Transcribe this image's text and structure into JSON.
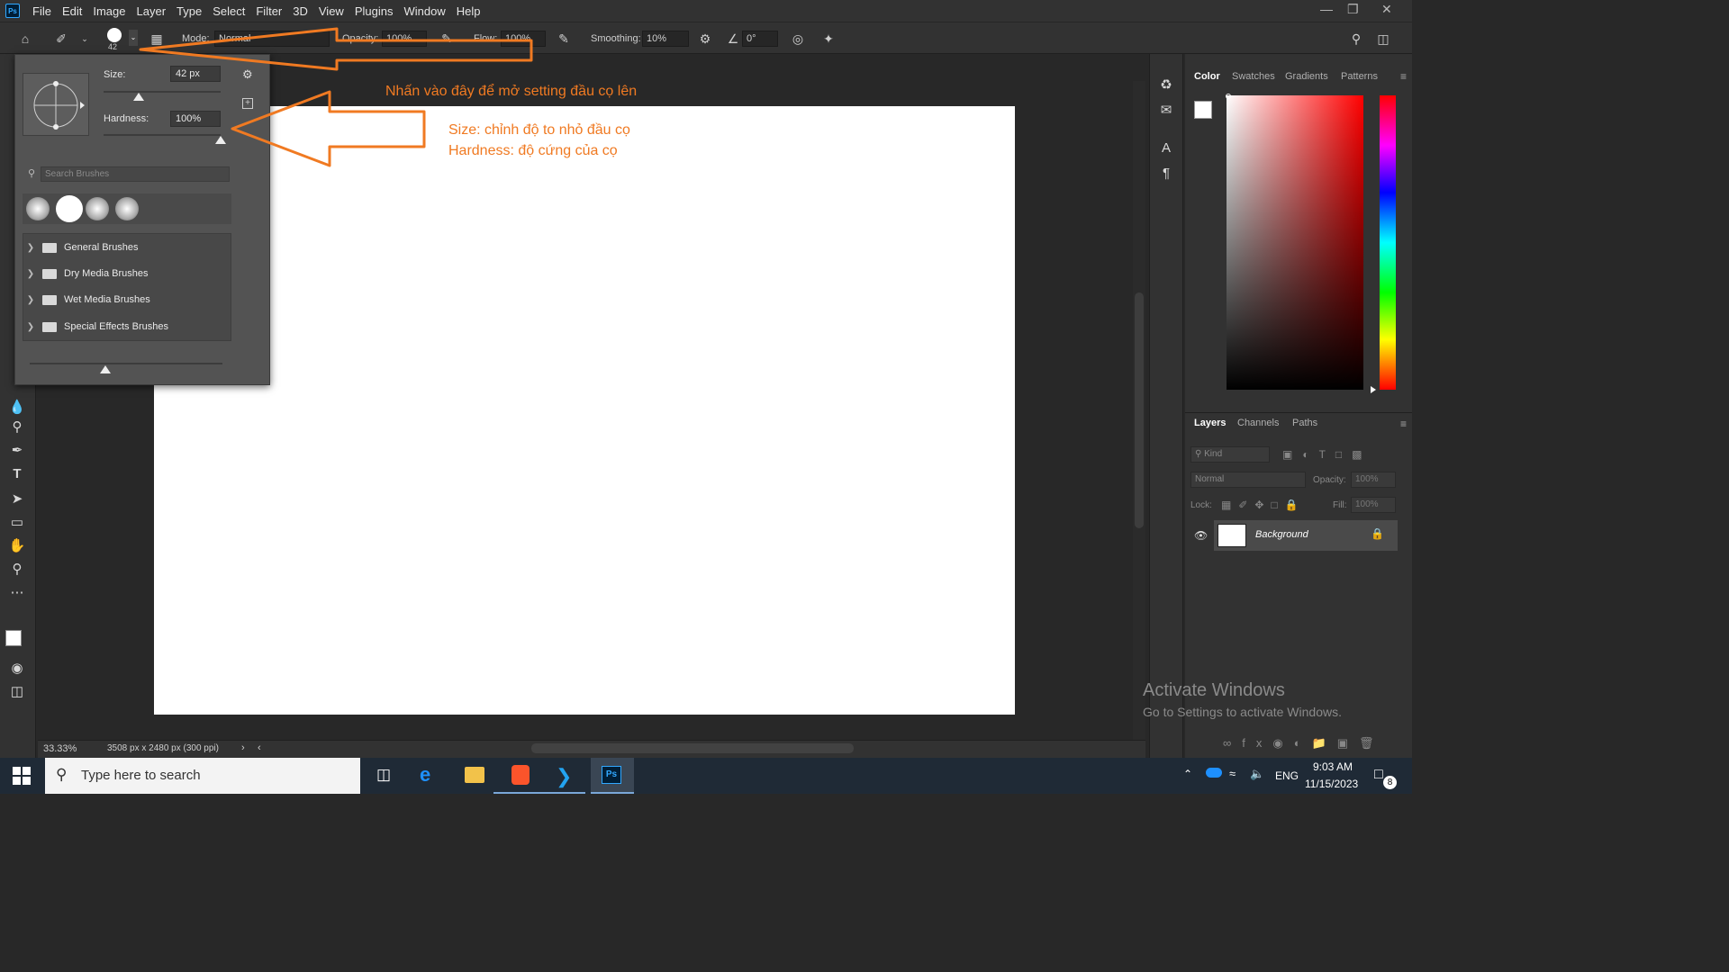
{
  "app": {
    "logo": "Ps",
    "menu": [
      "File",
      "Edit",
      "Image",
      "Layer",
      "Type",
      "Select",
      "Filter",
      "3D",
      "View",
      "Plugins",
      "Window",
      "Help"
    ]
  },
  "options_bar": {
    "brush_size": "42",
    "mode_label": "Mode:",
    "mode_value": "Normal",
    "opacity_label": "Opacity:",
    "opacity_value": "100%",
    "flow_label": "Flow:",
    "flow_value": "100%",
    "smoothing_label": "Smoothing:",
    "smoothing_value": "10%",
    "angle_value": "0°"
  },
  "brush_popup": {
    "size_label": "Size:",
    "size_value": "42 px",
    "size_slider_fraction": 0.3,
    "hardness_label": "Hardness:",
    "hardness_value": "100%",
    "hardness_slider_fraction": 1.0,
    "search_placeholder": "Search Brushes",
    "folders": [
      "General Brushes",
      "Dry Media Brushes",
      "Wet Media Brushes",
      "Special Effects Brushes"
    ]
  },
  "annotations": {
    "top": "Nhấn vào đây để mở setting đầu cọ lên",
    "size_note": "Size: chỉnh độ to nhỏ đầu cọ",
    "hardness_note": "Hardness: độ cứng của cọ",
    "color": "#f07a22"
  },
  "status_bar": {
    "zoom": "33.33%",
    "doc_info": "3508 px x 2480 px (300 ppi)"
  },
  "color_panel": {
    "tabs": [
      "Color",
      "Swatches",
      "Gradients",
      "Patterns"
    ]
  },
  "layers_panel": {
    "tabs": [
      "Layers",
      "Channels",
      "Paths"
    ],
    "kind_placeholder": "Kind",
    "blend_mode": "Normal",
    "opacity_label": "Opacity:",
    "opacity_value": "100%",
    "lock_label": "Lock:",
    "fill_label": "Fill:",
    "fill_value": "100%",
    "layer_name": "Background"
  },
  "watermark": {
    "title": "Activate Windows",
    "subtitle": "Go to Settings to activate Windows."
  },
  "taskbar": {
    "search_placeholder": "Type here to search",
    "lang": "ENG",
    "time": "9:03 AM",
    "date": "11/15/2023",
    "notifications": "8"
  }
}
